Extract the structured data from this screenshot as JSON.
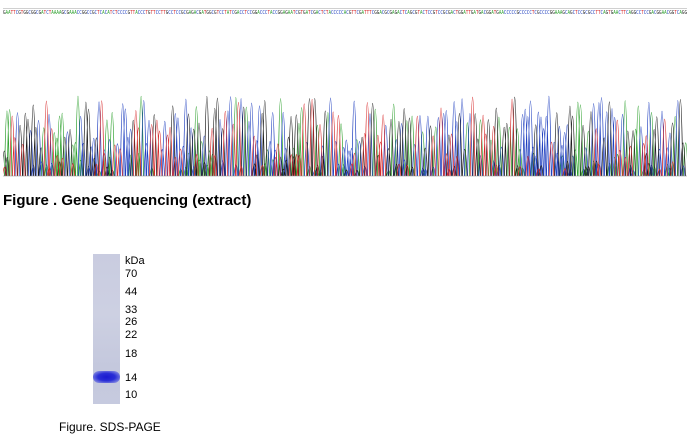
{
  "sequence_strip": {
    "bases": "GAATTCGTGGCGGCGATCTAAAAGCGAAACCGGCCGCTCACATCTCCCCGTTACCCTGTTCCTTGCCTCCGCGAGACGATGGCGTCCTATCGACCTCCGGACCCTACCGGAGAATCGTGATCGACTCTACCCCCACGTTCGATTTCGGACGCGAGACTCAGCGTACTCCGTCCGCGACTGGATTGATGACGGATGAACCCCCGCCCCCTCGCCCCGGAAAGCAGCTCCGCGCCTTCAGTGAACTTCAGGCCTCCGACGGAACGGTCAGG"
  },
  "chromatogram": {
    "colors": {
      "A": "#2ca02c",
      "C": "#1f3fbf",
      "G": "#1a1a1a",
      "T": "#d62728"
    }
  },
  "figures": {
    "sequencing_caption": "Figure . Gene Sequencing (extract)",
    "sds_caption": "Figure. SDS-PAGE"
  },
  "gel": {
    "unit": "kDa",
    "markers": [
      "70",
      "44",
      "33",
      "26",
      "22",
      "18",
      "14",
      "10"
    ],
    "band_color": "#1a1ad0",
    "lane_color": "#c9cce0"
  }
}
